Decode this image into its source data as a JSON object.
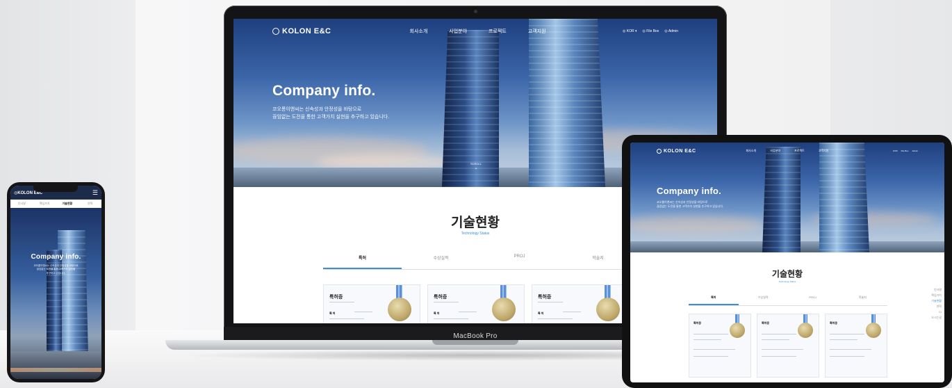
{
  "brand": {
    "name": "KOLON E&C"
  },
  "nav": {
    "menu": [
      "회사소개",
      "사업분야",
      "프로젝트",
      "고객지원"
    ],
    "util": [
      {
        "icon": "globe-icon",
        "label": "KOR"
      },
      {
        "icon": "file-icon",
        "label": "File Box"
      },
      {
        "icon": "user-icon",
        "label": "Admin"
      }
    ]
  },
  "hero": {
    "title": "Company info.",
    "sub_line1": "코오롱이앤씨는 신속성과 안정성을 바탕으로",
    "sub_line2": "끊임없는 도전을 통한 고객가치 실현을 추구하고 있습니다.",
    "scroll_label": "SCROLL"
  },
  "section": {
    "title": "기술현황",
    "subtitle": "Technology Status",
    "tabs": [
      "특허",
      "수상실적",
      "PROJ",
      "학술지"
    ],
    "active_tab": 0
  },
  "cards": [
    {
      "title": "특허증",
      "label": "특 허"
    },
    {
      "title": "특허증",
      "label": "특 허"
    },
    {
      "title": "특허증",
      "label": "특 허"
    }
  ],
  "phone": {
    "tabs": [
      "인사말",
      "핵심가치",
      "기술현황",
      "연혁"
    ],
    "active_tab": 2,
    "sub_line1": "코오롱이앤씨는 신속성과 안정성을 바탕으로",
    "sub_line2": "끊임없는 도전을 통한 고객가치 실현을",
    "sub_line3": "추구하고 있습니다."
  },
  "tablet": {
    "side_nav": [
      "인사말",
      "핵심가치",
      "기술현황",
      "연혁",
      "CI",
      "오시는길"
    ],
    "side_nav_active": 2
  },
  "device": {
    "laptop_label": "MacBook Pro"
  },
  "colors": {
    "accent": "#3b8ed6",
    "hero_sky": "#3b66a9",
    "device_frame": "#141416"
  }
}
